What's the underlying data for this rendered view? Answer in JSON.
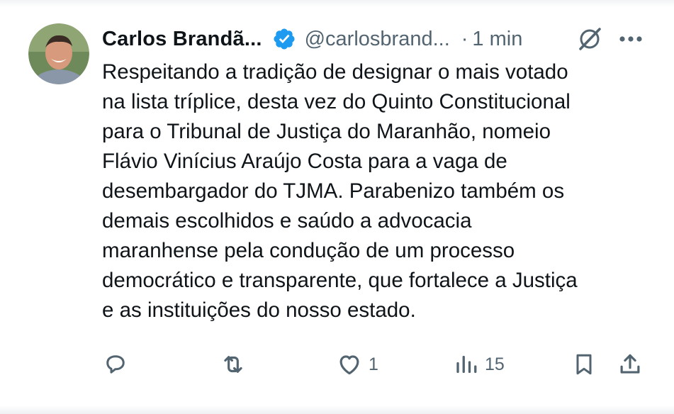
{
  "tweet": {
    "author_name": "Carlos Brandã...",
    "handle": "@carlosbrand...",
    "separator": "·",
    "time": "1 min",
    "verified": true,
    "text": "Respeitando a tradição de designar o mais votado\nna lista tríplice, desta vez do Quinto Constitucional\npara o Tribunal de Justiça do Maranhão, nomeio\nFlávio Vinícius Araújo Costa para a vaga de\ndesembargador do TJMA. Parabenizo também os\ndemais escolhidos e saúdo a advocacia\nmaranhense pela condução de um processo\ndemocrático e transparente, que fortalece a Justiça\ne as instituições do nosso estado."
  },
  "actions": {
    "reply_icon": "reply-icon",
    "retweet_icon": "retweet-icon",
    "like_icon": "heart-icon",
    "like_count": "1",
    "views_icon": "views-icon",
    "views_count": "15",
    "bookmark_icon": "bookmark-icon",
    "share_icon": "share-icon"
  },
  "colors": {
    "text": "#0f1419",
    "muted": "#536471",
    "verified_badge": "#1d9bf0"
  }
}
